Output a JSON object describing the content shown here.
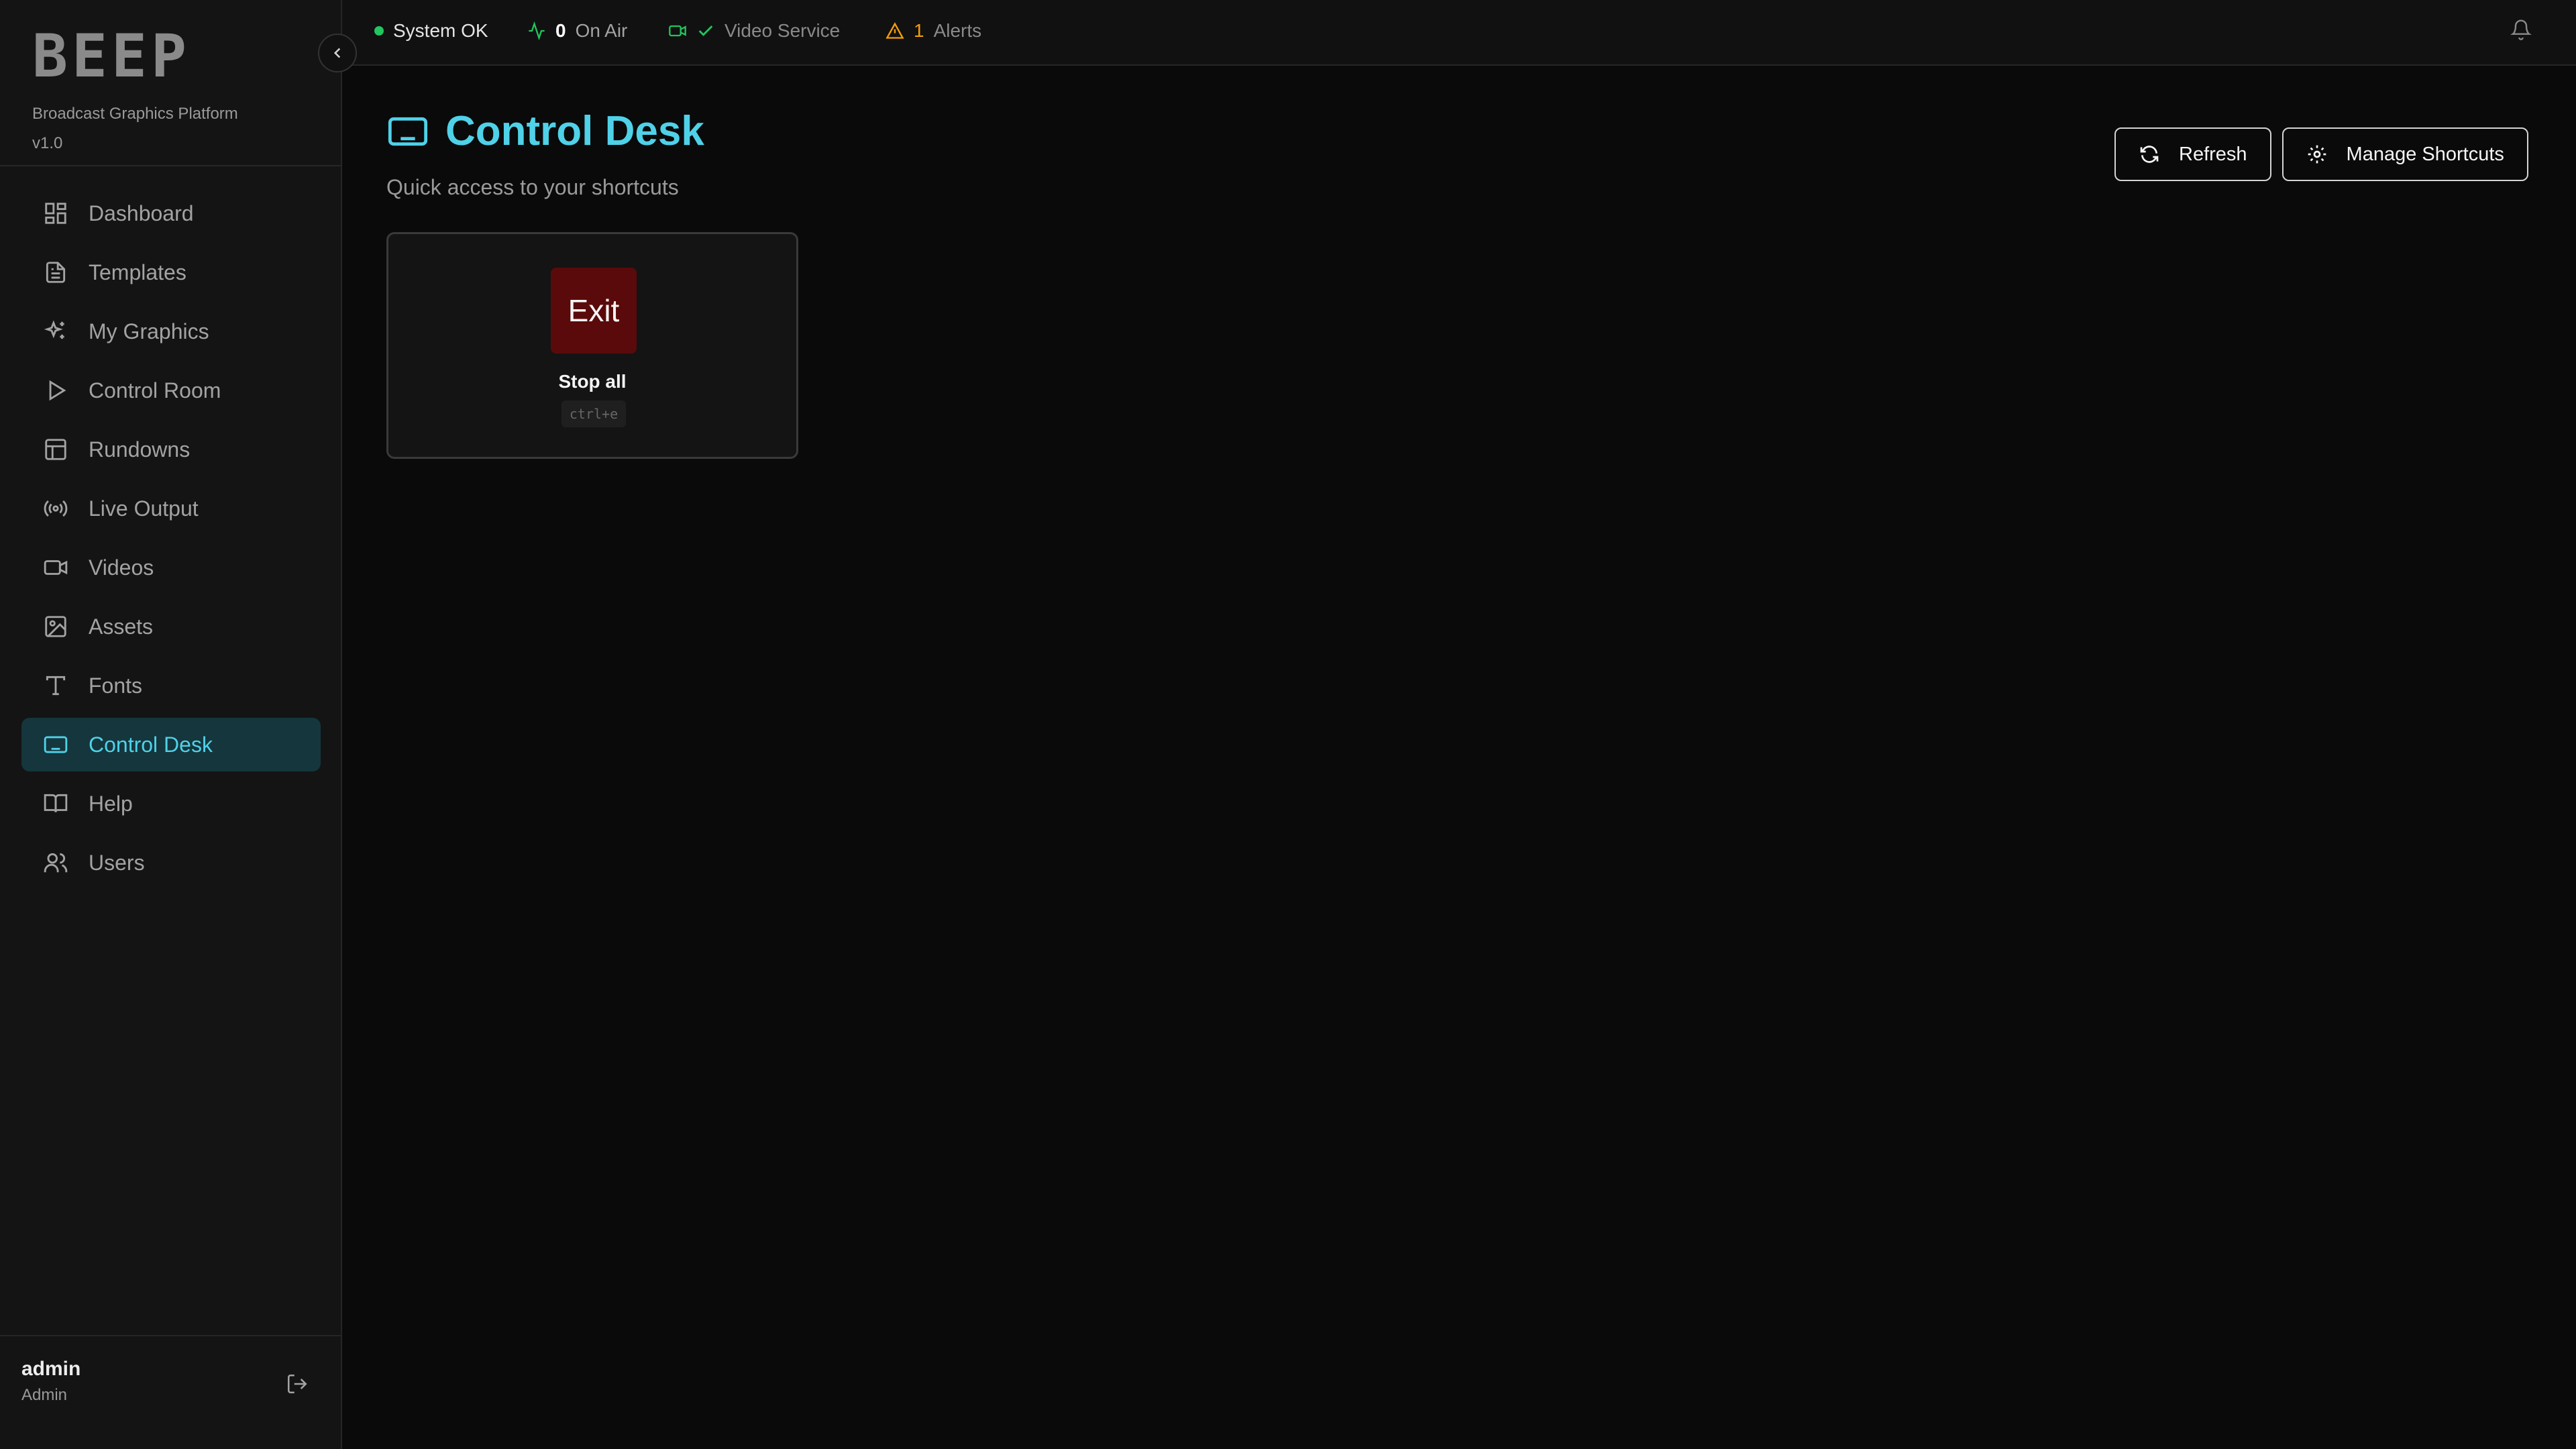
{
  "brand": {
    "logo": "BEEP",
    "subtitle": "Broadcast Graphics Platform",
    "version": "v1.0"
  },
  "sidebar": {
    "items": [
      {
        "label": "Dashboard",
        "icon": "dashboard-icon",
        "active": false
      },
      {
        "label": "Templates",
        "icon": "file-text-icon",
        "active": false
      },
      {
        "label": "My Graphics",
        "icon": "sparkles-icon",
        "active": false
      },
      {
        "label": "Control Room",
        "icon": "play-icon",
        "active": false
      },
      {
        "label": "Rundowns",
        "icon": "table-icon",
        "active": false
      },
      {
        "label": "Live Output",
        "icon": "radio-icon",
        "active": false
      },
      {
        "label": "Videos",
        "icon": "video-icon",
        "active": false
      },
      {
        "label": "Assets",
        "icon": "image-icon",
        "active": false
      },
      {
        "label": "Fonts",
        "icon": "type-icon",
        "active": false
      },
      {
        "label": "Control Desk",
        "icon": "keyboard-icon",
        "active": true
      },
      {
        "label": "Help",
        "icon": "book-icon",
        "active": false
      },
      {
        "label": "Users",
        "icon": "users-icon",
        "active": false
      }
    ]
  },
  "user": {
    "name": "admin",
    "role": "Admin"
  },
  "topbar": {
    "system_status": "System OK",
    "on_air_count": "0",
    "on_air_label": "On Air",
    "video_service_label": "Video Service",
    "alerts_count": "1",
    "alerts_label": "Alerts"
  },
  "page": {
    "title": "Control Desk",
    "subtitle": "Quick access to your shortcuts"
  },
  "actions": {
    "refresh_label": "Refresh",
    "manage_label": "Manage Shortcuts"
  },
  "shortcuts": [
    {
      "key_label": "Exit",
      "label": "Stop all",
      "keys": "ctrl+e",
      "color": "#5a0a0a"
    }
  ],
  "colors": {
    "accent": "#4fd1e8",
    "ok": "#22c55e",
    "warning": "#f59e0b",
    "active_bg": "#15363d"
  }
}
